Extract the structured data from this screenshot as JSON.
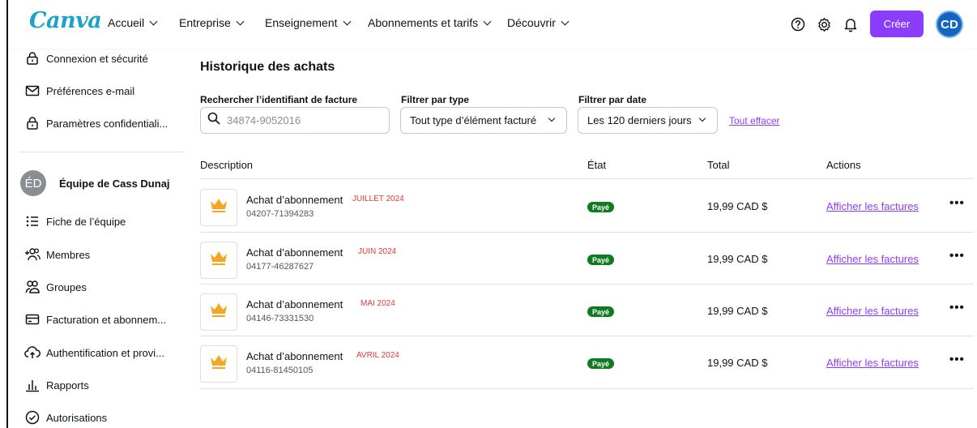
{
  "brand": {
    "logo_text": "Canva",
    "accent_color": "#8b3dff",
    "logo_color": "#1aa3c8"
  },
  "header": {
    "nav": [
      {
        "label": "Accueil"
      },
      {
        "label": "Entreprise"
      },
      {
        "label": "Enseignement"
      },
      {
        "label": "Abonnements et tarifs"
      },
      {
        "label": "Découvrir"
      }
    ],
    "icons": [
      "help-icon",
      "settings-icon",
      "bell-icon"
    ],
    "create_label": "Créer",
    "avatar_initials": "CD"
  },
  "sidebar": {
    "top_items": [
      {
        "label": "Connexion et sécurité",
        "icon": "lock-icon"
      },
      {
        "label": "Préférences e-mail",
        "icon": "mail-icon"
      },
      {
        "label": "Paramètres confidentiali...",
        "icon": "lock-icon"
      }
    ],
    "team": {
      "initials": "ÉD",
      "name": "Équipe de Cass Dunaj"
    },
    "team_items": [
      {
        "label": "Fiche de l’équipe",
        "icon": "list-icon"
      },
      {
        "label": "Membres",
        "icon": "add-people-icon"
      },
      {
        "label": "Groupes",
        "icon": "group-icon"
      },
      {
        "label": "Facturation et abonnem...",
        "icon": "card-icon"
      },
      {
        "label": "Authentification et provi...",
        "icon": "cloud-upload-icon"
      },
      {
        "label": "Rapports",
        "icon": "bar-chart-icon"
      },
      {
        "label": "Autorisations",
        "icon": "check-circle-icon"
      }
    ]
  },
  "main": {
    "title": "Historique des achats",
    "search": {
      "label": "Rechercher l’identifiant de facture",
      "placeholder": "34874-9052016"
    },
    "filter_type": {
      "label": "Filtrer par type",
      "selected": "Tout type d’élément facturé"
    },
    "filter_date": {
      "label": "Filtrer par date",
      "selected": "Les 120 derniers jours"
    },
    "clear_all": "Tout effacer",
    "columns": [
      "Description",
      "État",
      "Total",
      "Actions"
    ],
    "rows": [
      {
        "title": "Achat d’abonnement",
        "month": "JUILLET 2024",
        "invoice_id": "04207-71394283",
        "status": "Payé",
        "total": "19,99 CAD $",
        "action": "Afficher les factures",
        "more": "•••"
      },
      {
        "title": "Achat d’abonnement",
        "month": "JUIN 2024",
        "invoice_id": "04177-46287627",
        "status": "Payé",
        "total": "19,99 CAD $",
        "action": "Afficher les factures",
        "more": "•••"
      },
      {
        "title": "Achat d’abonnement",
        "month": "MAI 2024",
        "invoice_id": "04146-73331530",
        "status": "Payé",
        "total": "19,99 CAD $",
        "action": "Afficher les factures",
        "more": "•••"
      },
      {
        "title": "Achat d’abonnement",
        "month": "AVRIL 2024",
        "invoice_id": "04116-81450105",
        "status": "Payé",
        "total": "19,99 CAD $",
        "action": "Afficher les factures",
        "more": "•••"
      }
    ]
  }
}
